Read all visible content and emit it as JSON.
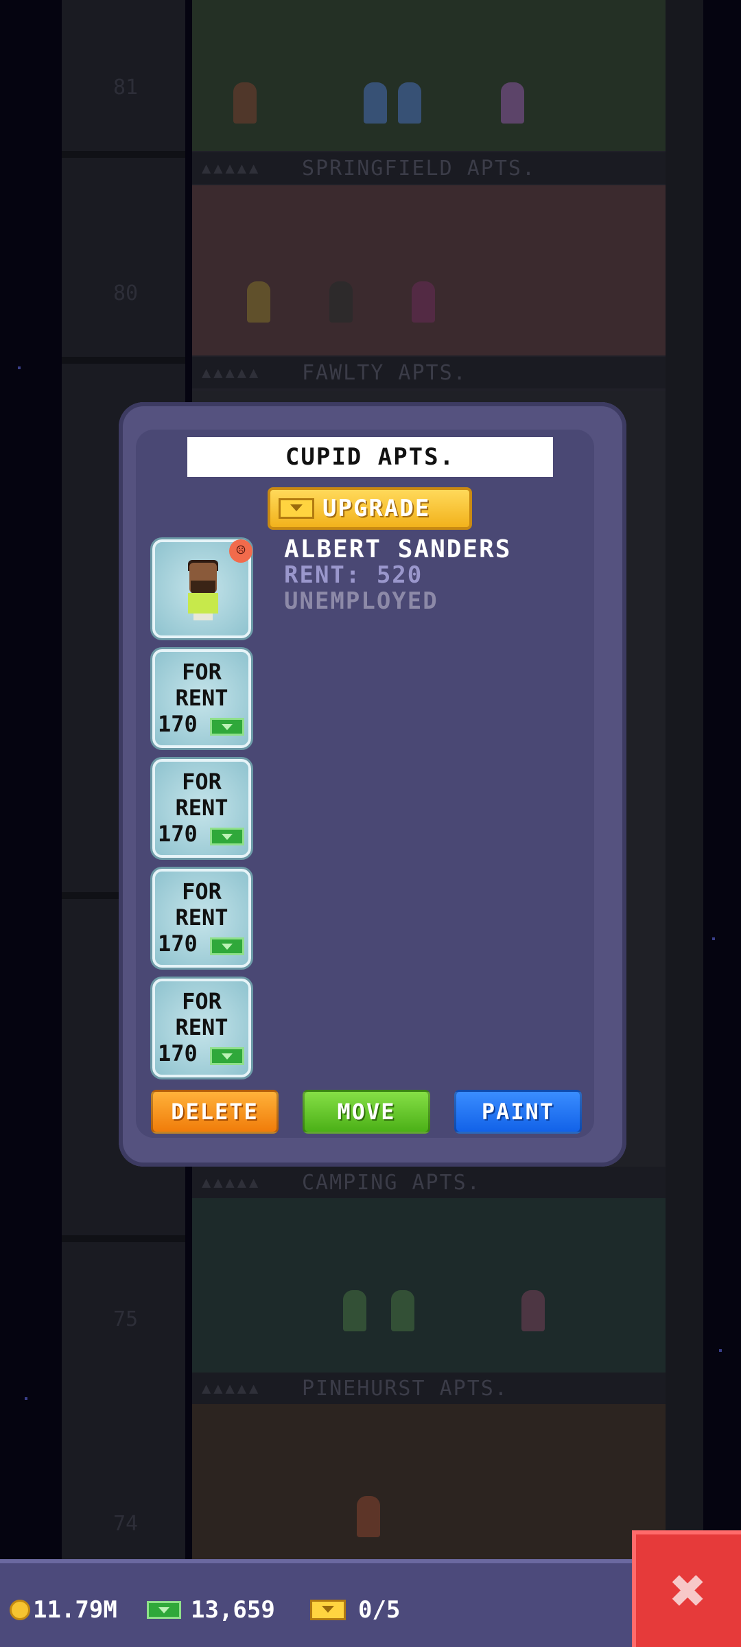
{
  "background": {
    "floors": [
      {
        "number": "81",
        "label": "SPRINGFIELD APTS."
      },
      {
        "number": "80",
        "label": "FAWLTY APTS."
      },
      {
        "number": "",
        "label": "CAMPING APTS."
      },
      {
        "number": "75",
        "label": "PINEHURST APTS."
      },
      {
        "number": "74",
        "label": ""
      }
    ]
  },
  "dialog": {
    "title": "CUPID APTS.",
    "upgrade_label": "UPGRADE",
    "upgrade_icon": "bux-icon",
    "resident": {
      "name": "ALBERT SANDERS",
      "rent": "RENT: 520",
      "job": "UNEMPLOYED",
      "mood_icon": "sad-face-icon",
      "mood_color": "#f26b4c"
    },
    "vacant_slots": [
      {
        "line1": "FOR",
        "line2": "RENT",
        "price": "170"
      },
      {
        "line1": "FOR",
        "line2": "RENT",
        "price": "170"
      },
      {
        "line1": "FOR",
        "line2": "RENT",
        "price": "170"
      },
      {
        "line1": "FOR",
        "line2": "RENT",
        "price": "170"
      }
    ],
    "actions": {
      "delete": "DELETE",
      "move": "MOVE",
      "paint": "PAINT"
    }
  },
  "status_bar": {
    "coins": "11.79M",
    "cash": "13,659",
    "bux": "0/5"
  },
  "colors": {
    "delete": "#f07c0a",
    "move": "#4bb017",
    "paint": "#1262e8",
    "close": "#e63a3a",
    "panel": "#4a4874"
  }
}
